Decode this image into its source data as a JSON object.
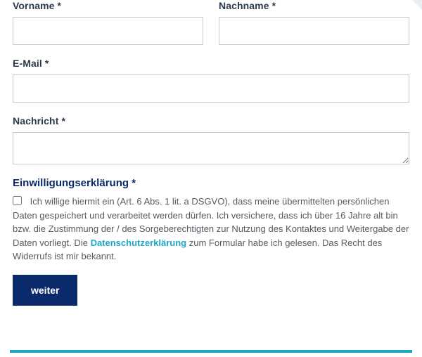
{
  "form": {
    "firstName": {
      "label": "Vorname *",
      "value": ""
    },
    "lastName": {
      "label": "Nachname *",
      "value": ""
    },
    "email": {
      "label": "E-Mail *",
      "value": ""
    },
    "message": {
      "label": "Nachricht *",
      "value": ""
    }
  },
  "consent": {
    "heading": "Einwilligungserklärung *",
    "text_before": "Ich willige hiermit ein (Art. 6 Abs. 1 lit. a DSGVO), dass meine übermittelten persönlichen Daten gespeichert und verarbeitet werden dürfen. Ich versichere, dass ich über 16 Jahre alt bin bzw. die Zustimmung der / des Sorgeberechtigten zur Nutzung des Kontaktes und Weitergabe der Daten vorliegt. Die ",
    "link_label": "Datenschutzerklärung",
    "text_after": " zum Formular habe ich gelesen. Das Recht des Widerrufs ist mir bekannt.",
    "checked": false
  },
  "actions": {
    "submit_label": "weiter"
  }
}
